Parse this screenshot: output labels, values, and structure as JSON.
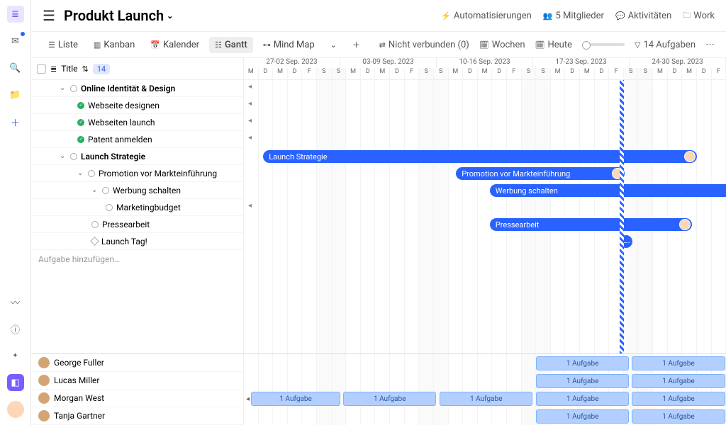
{
  "page": {
    "title": "Produkt Launch"
  },
  "top_actions": {
    "automations": "Automatisierungen",
    "members": "5 Mitglieder",
    "activities": "Aktivitäten",
    "work": "Work"
  },
  "views": {
    "list": "Liste",
    "kanban": "Kanban",
    "calendar": "Kalender",
    "gantt": "Gantt",
    "mindmap": "Mind Map"
  },
  "tools": {
    "not_connected": "Nicht verbunden (0)",
    "weeks": "Wochen",
    "today": "Heute",
    "task_count": "14 Aufgaben"
  },
  "columns": {
    "title_label": "Title",
    "task_count_badge": "14"
  },
  "timeline": {
    "weeks": [
      "27-02 Sep. 2023",
      "03-09 Sep. 2023",
      "10-16 Sep. 2023",
      "17-23 Sep. 2023",
      "24-30 Sep. 2023"
    ],
    "days": [
      "M",
      "D",
      "M",
      "D",
      "F",
      "S",
      "S",
      "M",
      "D",
      "M",
      "D",
      "F",
      "S",
      "S",
      "M",
      "D",
      "M",
      "D",
      "F",
      "S",
      "S",
      "M",
      "D",
      "M",
      "D",
      "F",
      "S",
      "S",
      "M",
      "D",
      "M",
      "D",
      "F"
    ]
  },
  "tasks": [
    {
      "label": "Online Identität & Design",
      "indent": 1,
      "chevron": true,
      "bold": true,
      "status": "open"
    },
    {
      "label": "Webseite designen",
      "indent": 2,
      "status": "done"
    },
    {
      "label": "Webseiten launch",
      "indent": 2,
      "status": "done"
    },
    {
      "label": "Patent anmelden",
      "indent": 2,
      "status": "done"
    },
    {
      "label": "Launch Strategie",
      "indent": 1,
      "chevron": true,
      "bold": true,
      "status": "open"
    },
    {
      "label": "Promotion vor Markteinführung",
      "indent": 2,
      "chevron": true,
      "status": "open"
    },
    {
      "label": "Werbung schalten",
      "indent": 3,
      "chevron": true,
      "status": "open"
    },
    {
      "label": "Marketingbudget",
      "indent": 4,
      "status": "open"
    },
    {
      "label": "Pressearbeit",
      "indent": 3,
      "status": "open"
    },
    {
      "label": "Launch Tag!",
      "indent": 3,
      "status": "milestone"
    }
  ],
  "add_task_placeholder": "Aufgabe hinzufügen…",
  "bars": {
    "launch_strategie": "Launch Strategie",
    "promotion": "Promotion vor Markteinführung",
    "werbung": "Werbung schalten",
    "pressearbeit": "Pressearbeit",
    "launch_tag": "L…"
  },
  "people": [
    {
      "name": "George Fuller"
    },
    {
      "name": "Lucas Miller"
    },
    {
      "name": "Morgan West"
    },
    {
      "name": "Tanja Gartner"
    }
  ],
  "workload_label": "1 Aufgabe"
}
